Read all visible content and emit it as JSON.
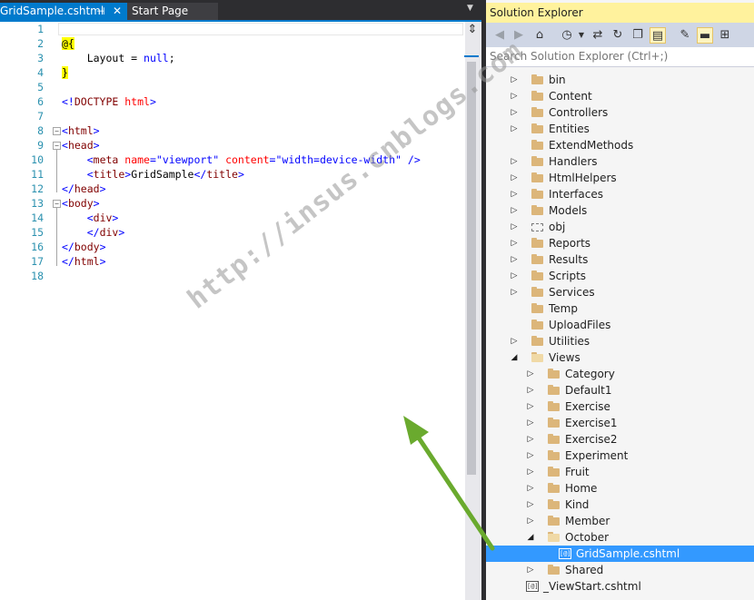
{
  "tabs": {
    "active": {
      "label": "GridSample.cshtml",
      "pin_icon": "pin-icon",
      "close_icon": "close-icon"
    },
    "inactive": {
      "label": "Start Page"
    }
  },
  "editor": {
    "line_numbers": [
      "1",
      "2",
      "3",
      "4",
      "5",
      "6",
      "7",
      "8",
      "9",
      "10",
      "11",
      "12",
      "13",
      "14",
      "15",
      "16",
      "17",
      "18"
    ],
    "line2": {
      "razor": "@{"
    },
    "line3": {
      "indent": "    ",
      "text": "Layout = ",
      "kw": "null",
      "end": ";"
    },
    "line4": {
      "razor": "}"
    },
    "line6": {
      "open": "<!",
      "tag": "DOCTYPE",
      "attr": " html",
      "close": ">"
    },
    "line8": {
      "open": "<",
      "tag": "html",
      "close": ">"
    },
    "line9": {
      "open": "<",
      "tag": "head",
      "close": ">"
    },
    "line10": {
      "indent": "    ",
      "open": "<",
      "tag": "meta",
      "attr1": " name",
      "eq1": "=",
      "val1": "\"viewport\"",
      "attr2": " content",
      "eq2": "=",
      "val2": "\"width=device-width\"",
      "close": " />"
    },
    "line11": {
      "indent": "    ",
      "open": "<",
      "tag": "title",
      "close": ">",
      "text": "GridSample",
      "open2": "</",
      "tag2": "title",
      "close2": ">"
    },
    "line12": {
      "open": "</",
      "tag": "head",
      "close": ">"
    },
    "line13": {
      "open": "<",
      "tag": "body",
      "close": ">"
    },
    "line14": {
      "indent": "    ",
      "open": "<",
      "tag": "div",
      "close": ">"
    },
    "line15": {
      "indent": "    ",
      "open": "</",
      "tag": "div",
      "close": ">"
    },
    "line16": {
      "open": "</",
      "tag": "body",
      "close": ">"
    },
    "line17": {
      "open": "</",
      "tag": "html",
      "close": ">"
    }
  },
  "solution_explorer": {
    "title": "Solution Explorer",
    "search_placeholder": "Search Solution Explorer (Ctrl+;)",
    "toolbar_icons": [
      "back-icon",
      "forward-icon",
      "home-icon",
      "history-icon",
      "sync-icon",
      "refresh-icon",
      "collapse-icon",
      "show-files-icon",
      "properties-icon",
      "preview-icon",
      "class-view-icon"
    ],
    "items": [
      {
        "label": "bin",
        "icon": "folder",
        "expanded": false
      },
      {
        "label": "Content",
        "icon": "folder",
        "expanded": false
      },
      {
        "label": "Controllers",
        "icon": "folder",
        "expanded": false
      },
      {
        "label": "Entities",
        "icon": "folder",
        "expanded": false
      },
      {
        "label": "ExtendMethods",
        "icon": "folder",
        "expanded": null
      },
      {
        "label": "Handlers",
        "icon": "folder",
        "expanded": false
      },
      {
        "label": "HtmlHelpers",
        "icon": "folder",
        "expanded": false
      },
      {
        "label": "Interfaces",
        "icon": "folder",
        "expanded": false
      },
      {
        "label": "Models",
        "icon": "folder",
        "expanded": false
      },
      {
        "label": "obj",
        "icon": "folder-dashed",
        "expanded": false
      },
      {
        "label": "Reports",
        "icon": "folder",
        "expanded": false
      },
      {
        "label": "Results",
        "icon": "folder",
        "expanded": false
      },
      {
        "label": "Scripts",
        "icon": "folder",
        "expanded": false
      },
      {
        "label": "Services",
        "icon": "folder",
        "expanded": false
      },
      {
        "label": "Temp",
        "icon": "folder",
        "expanded": null
      },
      {
        "label": "UploadFiles",
        "icon": "folder",
        "expanded": null
      },
      {
        "label": "Utilities",
        "icon": "folder",
        "expanded": false
      },
      {
        "label": "Views",
        "icon": "folder-open",
        "expanded": true
      },
      {
        "label": "Category",
        "icon": "folder",
        "expanded": false
      },
      {
        "label": "Default1",
        "icon": "folder",
        "expanded": false
      },
      {
        "label": "Exercise",
        "icon": "folder",
        "expanded": false
      },
      {
        "label": "Exercise1",
        "icon": "folder",
        "expanded": false
      },
      {
        "label": "Exercise2",
        "icon": "folder",
        "expanded": false
      },
      {
        "label": "Experiment",
        "icon": "folder",
        "expanded": false
      },
      {
        "label": "Fruit",
        "icon": "folder",
        "expanded": false
      },
      {
        "label": "Home",
        "icon": "folder",
        "expanded": false
      },
      {
        "label": "Kind",
        "icon": "folder",
        "expanded": false
      },
      {
        "label": "Member",
        "icon": "folder",
        "expanded": false
      },
      {
        "label": "October",
        "icon": "folder-open",
        "expanded": true
      },
      {
        "label": "GridSample.cshtml",
        "icon": "razor-file",
        "expanded": null,
        "selected": true
      },
      {
        "label": "Shared",
        "icon": "folder",
        "expanded": false
      },
      {
        "label": "_ViewStart.cshtml",
        "icon": "razor-file",
        "expanded": null
      }
    ],
    "file_glyph": "[@]"
  },
  "watermark": "http://insus.cnblogs.com",
  "colors": {
    "accent": "#007acc",
    "selection": "#3399ff",
    "arrow": "#6aaa2e",
    "title_highlight": "#fff29d"
  }
}
